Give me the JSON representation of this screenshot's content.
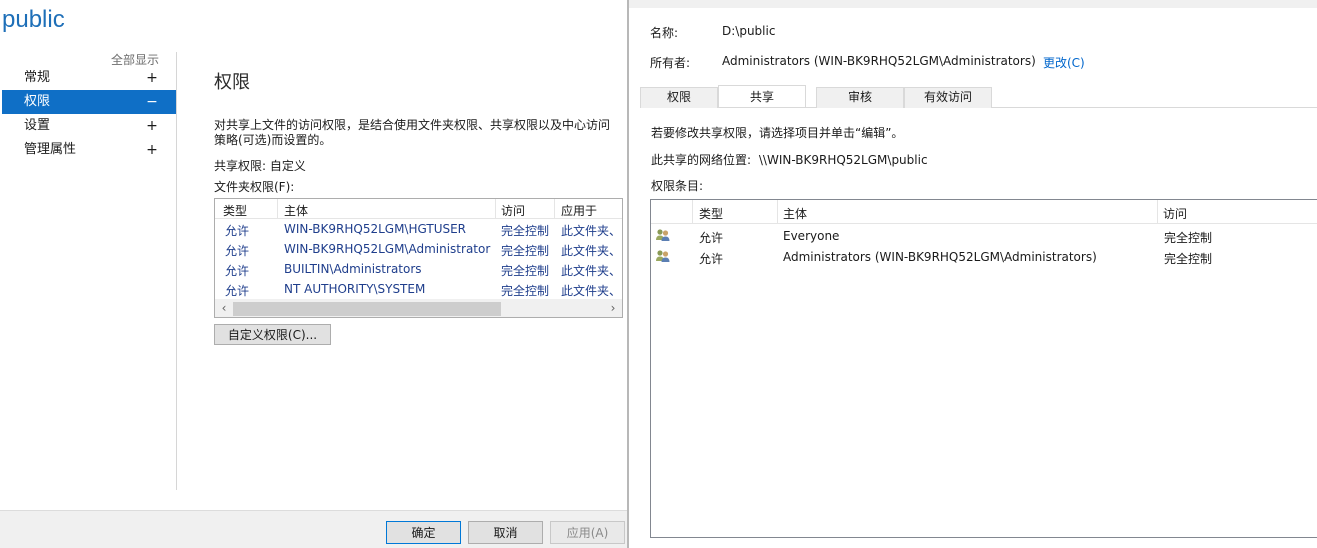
{
  "left": {
    "title": "public",
    "show_all": "全部显示",
    "nav": [
      {
        "label": "常规",
        "sign": "+"
      },
      {
        "label": "权限",
        "sign": "−"
      },
      {
        "label": "设置",
        "sign": "+"
      },
      {
        "label": "管理属性",
        "sign": "+"
      }
    ],
    "section_title": "权限",
    "description": "对共享上文件的访问权限，是结合使用文件夹权限、共享权限以及中心访问策略(可选)而设置的。",
    "share_permissions": "共享权限: 自定义",
    "folder_permissions": "文件夹权限(F):",
    "table": {
      "columns": [
        "类型",
        "主体",
        "访问",
        "应用于"
      ],
      "rows": [
        [
          "允许",
          "WIN-BK9RHQ52LGM\\HGTUSER",
          "完全控制",
          "此文件夹、"
        ],
        [
          "允许",
          "WIN-BK9RHQ52LGM\\Administrator",
          "完全控制",
          "此文件夹、"
        ],
        [
          "允许",
          "BUILTIN\\Administrators",
          "完全控制",
          "此文件夹、"
        ],
        [
          "允许",
          "NT AUTHORITY\\SYSTEM",
          "完全控制",
          "此文件夹、"
        ]
      ],
      "scroll_left": "‹",
      "scroll_right": "›"
    },
    "custom_button": "自定义权限(C)...",
    "footer": {
      "ok": "确定",
      "cancel": "取消",
      "apply": "应用(A)"
    }
  },
  "right": {
    "name_label": "名称:",
    "name_value": "D:\\public",
    "owner_label": "所有者:",
    "owner_value": "Administrators (WIN-BK9RHQ52LGM\\Administrators)",
    "change_link": "更改(C)",
    "tabs": [
      "权限",
      "共享",
      "审核",
      "有效访问"
    ],
    "instruction": "若要修改共享权限，请选择项目并单击“编辑”。",
    "network_location_label": "此共享的网络位置:",
    "network_location_value": "\\\\WIN-BK9RHQ52LGM\\public",
    "entries_label": "权限条目:",
    "table": {
      "columns": [
        "类型",
        "主体",
        "访问"
      ],
      "rows": [
        [
          "允许",
          "Everyone",
          "完全控制"
        ],
        [
          "允许",
          "Administrators (WIN-BK9RHQ52LGM\\Administrators)",
          "完全控制"
        ]
      ]
    }
  },
  "colors": {
    "accent": "#0f6fc6",
    "title_blue": "#1e6fb8",
    "link": "#0066cc",
    "row_text": "#1f3e8c"
  }
}
